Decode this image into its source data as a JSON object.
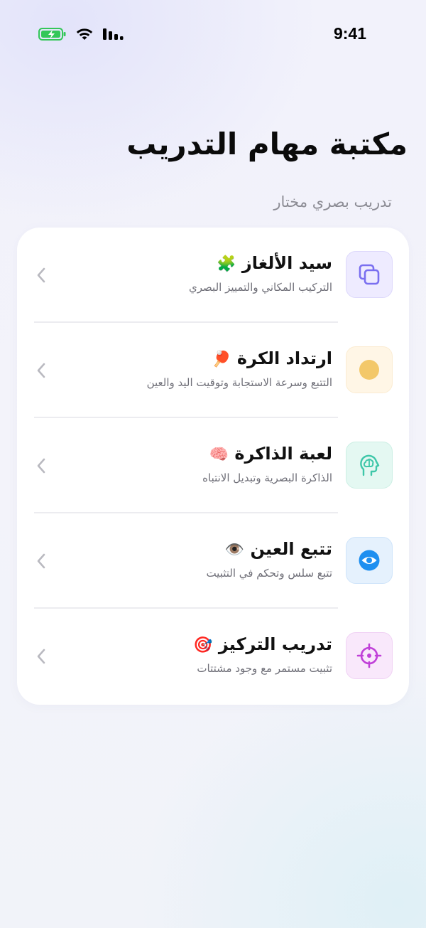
{
  "status": {
    "time": "9:41"
  },
  "header": {
    "title": "مكتبة مهام التدريب",
    "subtitle": "تدريب بصري مختار"
  },
  "tasks": [
    {
      "title": "سيد الألغاز",
      "emoji": "🧩",
      "desc": "التركيب المكاني والتمييز البصري",
      "icon": "copy-squares-icon",
      "icon_color": "#7a6ff0",
      "icon_bg": "#eeebff"
    },
    {
      "title": "ارتداد الكرة",
      "emoji": "🏓",
      "desc": "التتبع وسرعة الاستجابة وتوقيت اليد والعين",
      "icon": "ball-icon",
      "icon_color": "#f3c86a",
      "icon_bg": "#fff6e6"
    },
    {
      "title": "لعبة الذاكرة",
      "emoji": "🧠",
      "desc": "الذاكرة البصرية وتبديل الانتباه",
      "icon": "brain-head-icon",
      "icon_color": "#3ec7a9",
      "icon_bg": "#e4f8f2"
    },
    {
      "title": "تتبع العين",
      "emoji": "👁️",
      "desc": "تتبع سلس وتحكم في التثبيت",
      "icon": "eye-icon",
      "icon_color": "#1e8ff0",
      "icon_bg": "#e5f1fd"
    },
    {
      "title": "تدريب التركيز",
      "emoji": "🎯",
      "desc": "تثبيت مستمر مع وجود مشتتات",
      "icon": "crosshair-icon",
      "icon_color": "#c040d8",
      "icon_bg": "#f9e8fb"
    }
  ]
}
